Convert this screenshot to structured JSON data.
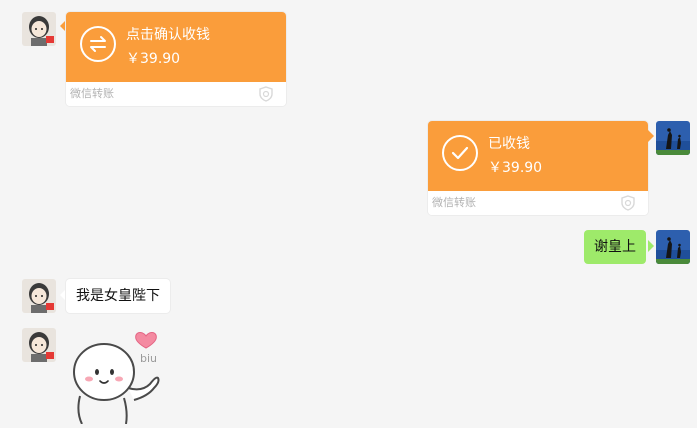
{
  "colors": {
    "transfer_orange": "#fa9d3b",
    "self_bubble_green": "#9eea6a",
    "background": "#f5f5f5"
  },
  "messages": [
    {
      "from": "other",
      "type": "transfer",
      "title": "点击确认收钱",
      "amount": "￥39.90",
      "footer": "微信转账",
      "icon": "exchange-arrows-icon"
    },
    {
      "from": "self",
      "type": "transfer",
      "title": "已收钱",
      "amount": "￥39.90",
      "footer": "微信转账",
      "icon": "checkmark-icon"
    },
    {
      "from": "self",
      "type": "text",
      "text": "谢皇上"
    },
    {
      "from": "other",
      "type": "text",
      "text": "我是女皇陛下"
    },
    {
      "from": "other",
      "type": "sticker",
      "sticker_text": "biu",
      "icon": "heart-sticker-icon"
    }
  ]
}
